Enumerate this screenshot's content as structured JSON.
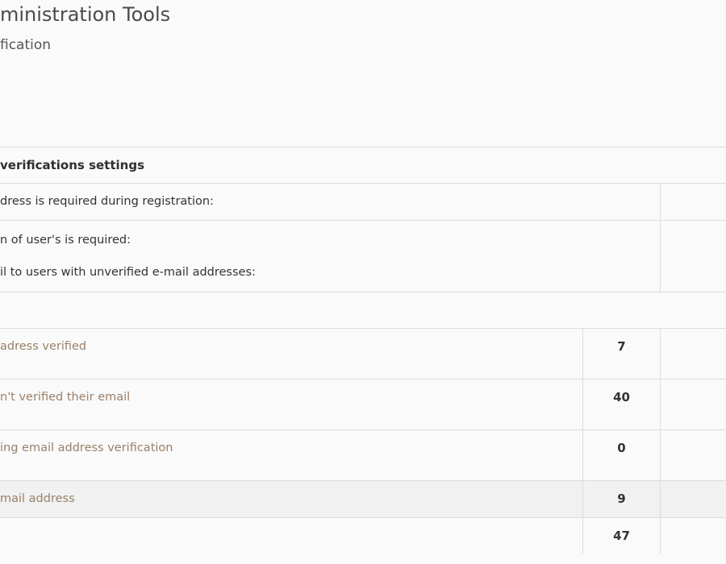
{
  "header": {
    "title": "ministration Tools",
    "subtitle": "fication"
  },
  "settings": {
    "heading": "verifications settings",
    "rows": [
      {
        "label": "dress is required during registration:"
      },
      {
        "label": "n of user's is required:"
      },
      {
        "label": "il to users with unverified e-mail addresses:"
      }
    ]
  },
  "stats": {
    "rows": [
      {
        "label": "adress verified",
        "count": "7"
      },
      {
        "label": "n't verified their email",
        "count": "40"
      },
      {
        "label": "ing email address verification",
        "count": "0"
      },
      {
        "label": "mail address",
        "count": "9"
      }
    ],
    "total": {
      "label": "",
      "count": "47"
    }
  }
}
